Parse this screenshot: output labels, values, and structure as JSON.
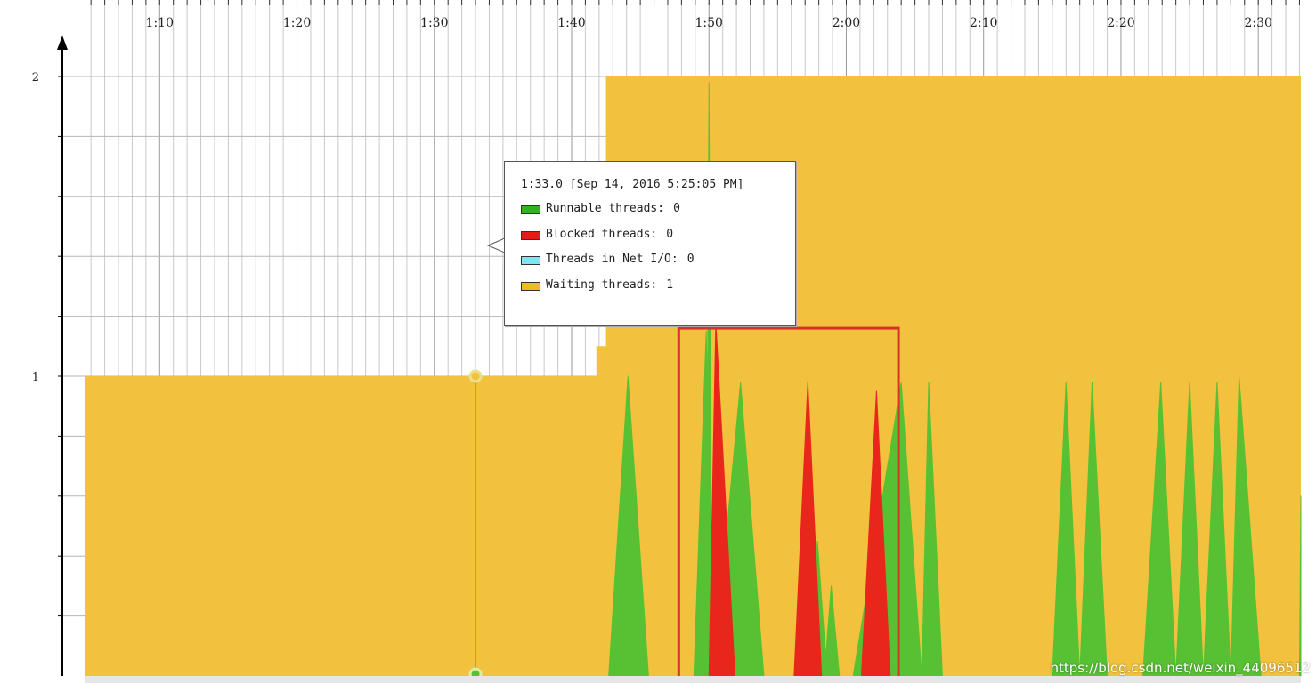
{
  "chart_data": {
    "type": "area",
    "x_axis": {
      "ticks": [
        {
          "value": 70,
          "label": "1:10"
        },
        {
          "value": 80,
          "label": "1:20"
        },
        {
          "value": 90,
          "label": "1:30"
        },
        {
          "value": 100,
          "label": "1:40"
        },
        {
          "value": 110,
          "label": "1:50"
        },
        {
          "value": 120,
          "label": "2:00"
        },
        {
          "value": 130,
          "label": "2:10"
        },
        {
          "value": 140,
          "label": "2:20"
        },
        {
          "value": 150,
          "label": "2:30"
        }
      ],
      "range_seconds": [
        64.6,
        153.1
      ],
      "unit": "seconds"
    },
    "y_axis": {
      "ticks": [
        {
          "value": 1,
          "label": "1"
        },
        {
          "value": 2,
          "label": "2"
        }
      ],
      "range": [
        0,
        2
      ]
    },
    "grid": true,
    "series": [
      {
        "name": "Waiting threads",
        "color": "#f2c23e",
        "points": [
          [
            64.6,
            1
          ],
          [
            101.8,
            1
          ],
          [
            101.8,
            1.1
          ],
          [
            102.5,
            1.1
          ],
          [
            102.5,
            2
          ],
          [
            153.1,
            2
          ]
        ]
      },
      {
        "name": "Runnable threads",
        "color": "#58c133",
        "spikes": [
          {
            "start": 102.7,
            "peak": 104.1,
            "end": 105.6,
            "height": 1
          },
          {
            "start": 108.9,
            "peak": 109.8,
            "end": 110.3,
            "height": 1.15
          },
          {
            "start": 109.8,
            "peak": 110.0,
            "end": 110.2,
            "height": 1.98
          },
          {
            "start": 110.3,
            "peak": 112.3,
            "end": 114.0,
            "height": 0.98
          },
          {
            "start": 117.2,
            "peak": 117.9,
            "end": 118.6,
            "height": 0.45
          },
          {
            "start": 118.4,
            "peak": 118.9,
            "end": 119.5,
            "height": 0.3
          },
          {
            "start": 120.5,
            "peak": 124.0,
            "end": 125.5,
            "height": 0.98
          },
          {
            "start": 125.5,
            "peak": 126.0,
            "end": 127.0,
            "height": 0.98
          },
          {
            "start": 135.0,
            "peak": 136.0,
            "end": 137.0,
            "height": 0.98
          },
          {
            "start": 137.0,
            "peak": 137.9,
            "end": 139.0,
            "height": 0.98
          },
          {
            "start": 141.6,
            "peak": 142.9,
            "end": 144.0,
            "height": 0.98
          },
          {
            "start": 144.0,
            "peak": 145.0,
            "end": 146.0,
            "height": 0.98
          },
          {
            "start": 146.0,
            "peak": 147.0,
            "end": 148.0,
            "height": 0.98
          },
          {
            "start": 148.0,
            "peak": 148.6,
            "end": 150.2,
            "height": 1
          },
          {
            "start": 153.0,
            "peak": 153.1,
            "end": 153.1,
            "height": 0.6
          }
        ]
      },
      {
        "name": "Blocked threads",
        "color": "#e8261c",
        "spikes": [
          {
            "start": 110.0,
            "peak": 110.5,
            "end": 111.9,
            "height": 1.18
          },
          {
            "start": 116.2,
            "peak": 117.2,
            "end": 118.2,
            "height": 0.98
          },
          {
            "start": 121.1,
            "peak": 122.2,
            "end": 123.2,
            "height": 0.95
          }
        ]
      },
      {
        "name": "Threads in Net I/O",
        "color": "#7fe5f0",
        "spikes": []
      }
    ],
    "crosshair": {
      "x": 93.0
    }
  },
  "tooltip": {
    "header": "1:33.0 [Sep 14, 2016 5:25:05 PM]",
    "rows": [
      {
        "label": "Runnable threads:",
        "value": "0",
        "color": "#34b020"
      },
      {
        "label": "Blocked threads:",
        "value": "0",
        "color": "#e01e14"
      },
      {
        "label": "Threads in Net I/O:",
        "value": "0",
        "color": "#7fe5f0"
      },
      {
        "label": "Waiting threads:",
        "value": "1",
        "color": "#f0bb1e"
      }
    ]
  },
  "highlight_box": {
    "color": "#d9322a",
    "x_range": [
      107.8,
      123.8
    ],
    "y_range": [
      0,
      1.16
    ]
  },
  "watermark": "https://blog.csdn.net/weixin_44096512"
}
